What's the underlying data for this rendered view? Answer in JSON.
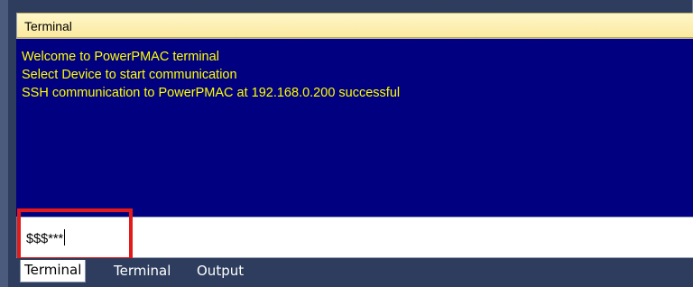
{
  "panel": {
    "title": "Terminal"
  },
  "output": {
    "lines": [
      "Welcome to PowerPMAC terminal",
      "Select Device to start communication",
      "SSH communication to PowerPMAC at 192.168.0.200 successful"
    ]
  },
  "input": {
    "value": "$$$***"
  },
  "tabs": [
    {
      "label": "Terminal",
      "active": true
    },
    {
      "label": "Terminal",
      "active": false
    },
    {
      "label": "Output",
      "active": false
    }
  ],
  "colors": {
    "output_background": "#000080",
    "output_text": "#ffff00",
    "title_bar": "#fbe9a0",
    "highlight": "#e41a1a",
    "frame": "#2e3d5e"
  }
}
